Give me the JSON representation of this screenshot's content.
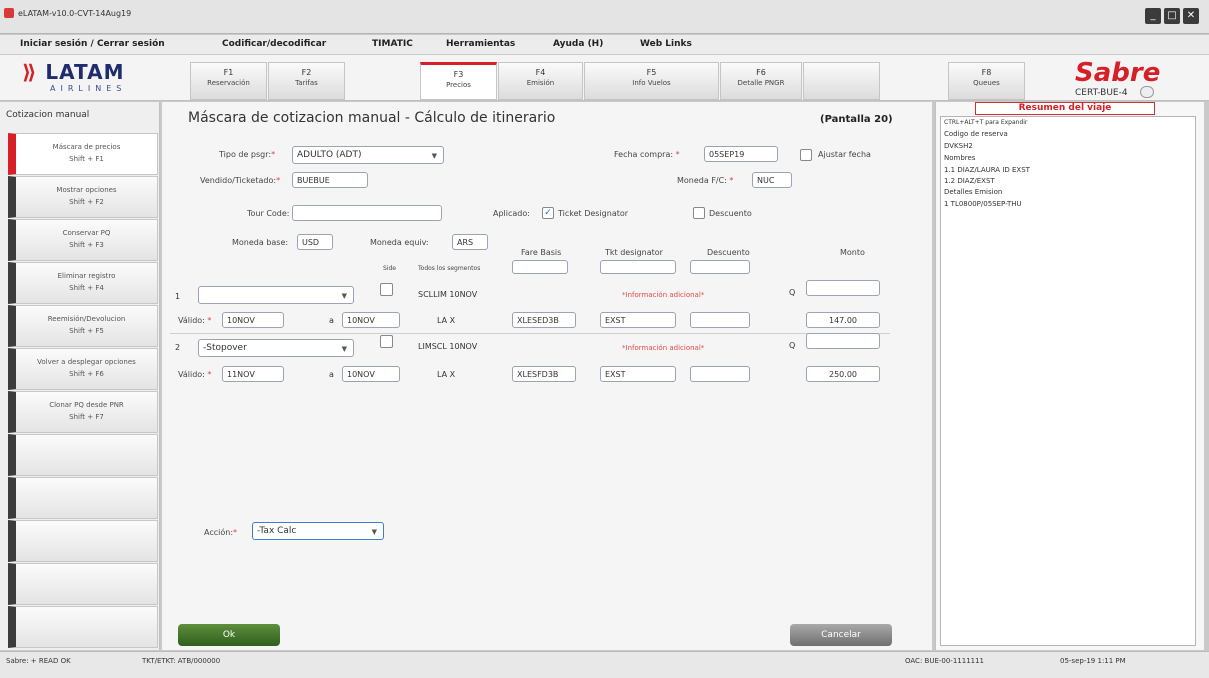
{
  "window": {
    "title": "eLATAM-v10.0-CVT-14Aug19"
  },
  "menu": [
    "Iniciar sesión / Cerrar sesión",
    "Codificar/decodificar",
    "TIMATIC",
    "Herramientas",
    "Ayuda (H)",
    "Web Links"
  ],
  "brand": {
    "latam": "LATAM",
    "airlines": "AIRLINES",
    "sabre": "Sabre",
    "cert": "CERT-BUE-4"
  },
  "fkeys": [
    {
      "key": "F1",
      "label": "Reservación"
    },
    {
      "key": "F2",
      "label": "Tarifas"
    },
    {
      "key": "F3",
      "label": "Precios"
    },
    {
      "key": "F4",
      "label": "Emisión"
    },
    {
      "key": "F5",
      "label": "Info Vuelos"
    },
    {
      "key": "F6",
      "label": "Detalle PNGR"
    },
    {
      "key": "",
      "label": ""
    },
    {
      "key": "F8",
      "label": "Queues"
    }
  ],
  "left": {
    "title": "Cotizacion manual",
    "buttons": [
      {
        "label": "Máscara de precios",
        "shortcut": "Shift + F1"
      },
      {
        "label": "Mostrar opciones",
        "shortcut": "Shift + F2"
      },
      {
        "label": "Conservar PQ",
        "shortcut": "Shift + F3"
      },
      {
        "label": "Eliminar registro",
        "shortcut": "Shift + F4"
      },
      {
        "label": "Reemisión/Devolucion",
        "shortcut": "Shift + F5"
      },
      {
        "label": "Volver a desplegar opciones",
        "shortcut": "Shift + F6"
      },
      {
        "label": "Clonar PQ desde PNR",
        "shortcut": "Shift + F7"
      }
    ]
  },
  "form": {
    "title": "Máscara de cotizacion manual - Cálculo de itinerario",
    "pantalla": "(Pantalla 20)",
    "tipo_pax_label": "Tipo de psgr:",
    "tipo_pax_value": "ADULTO (ADT)",
    "fecha_compra_label": "Fecha compra:",
    "fecha_compra_value": "05SEP19",
    "ajustar_fecha_label": "Ajustar fecha",
    "vendido_label": "Vendido/Ticketado:",
    "vendido_value": "BUEBUE",
    "moneda_fc_label": "Moneda F/C:",
    "moneda_fc_value": "NUC",
    "tour_code_label": "Tour Code:",
    "tour_code_value": "",
    "aplicado_label": "Aplicado:",
    "ticket_designator_label": "Ticket Designator",
    "descuento_chk_label": "Descuento",
    "moneda_base_label": "Moneda base:",
    "moneda_base_value": "USD",
    "moneda_equiv_label": "Moneda equiv:",
    "moneda_equiv_value": "ARS",
    "col_fare_basis": "Fare Basis",
    "col_tkt_designator": "Tkt designator",
    "col_descuento": "Descuento",
    "col_monto": "Monto",
    "col_side": "Side",
    "col_todos": "Todos los segmentos",
    "segments": [
      {
        "num": "1",
        "select": "",
        "route": "SCLLIM 10NOV",
        "info": "*Información adicional*",
        "q": "Q",
        "valido_label": "Válido:",
        "from": "10NOV",
        "a": "a",
        "to": "10NOV",
        "carrier": "LA X",
        "fare_basis": "XLESED3B",
        "tkt": "EXST",
        "desc": "",
        "monto": "147.00"
      },
      {
        "num": "2",
        "select": "-Stopover",
        "route": "LIMSCL 10NOV",
        "info": "*Información adicional*",
        "q": "Q",
        "valido_label": "Válido:",
        "from": "11NOV",
        "a": "a",
        "to": "10NOV",
        "carrier": "LA X",
        "fare_basis": "XLESFD3B",
        "tkt": "EXST",
        "desc": "",
        "monto": "250.00"
      }
    ],
    "accion_label": "Acción:",
    "accion_value": "-Tax Calc",
    "ok": "Ok",
    "cancel": "Cancelar"
  },
  "summary": {
    "header": "Resumen del viaje",
    "lines": [
      "CTRL+ALT+T para Expandir",
      "Codigo de reserva",
      "DVKSH2",
      "Nombres",
      "1.1 DIAZ/LAURA ID EXST",
      "1.2 DIAZ/EXST",
      "Detalles Emision",
      "1 TL0800P/05SEP-THU"
    ]
  },
  "status": {
    "left": "Sabre: + READ OK",
    "mid": "TKT/ETKT: ATB/000000",
    "right1": "OAC: BUE-00-1111111",
    "right2": "05-sep-19 1:11 PM"
  }
}
